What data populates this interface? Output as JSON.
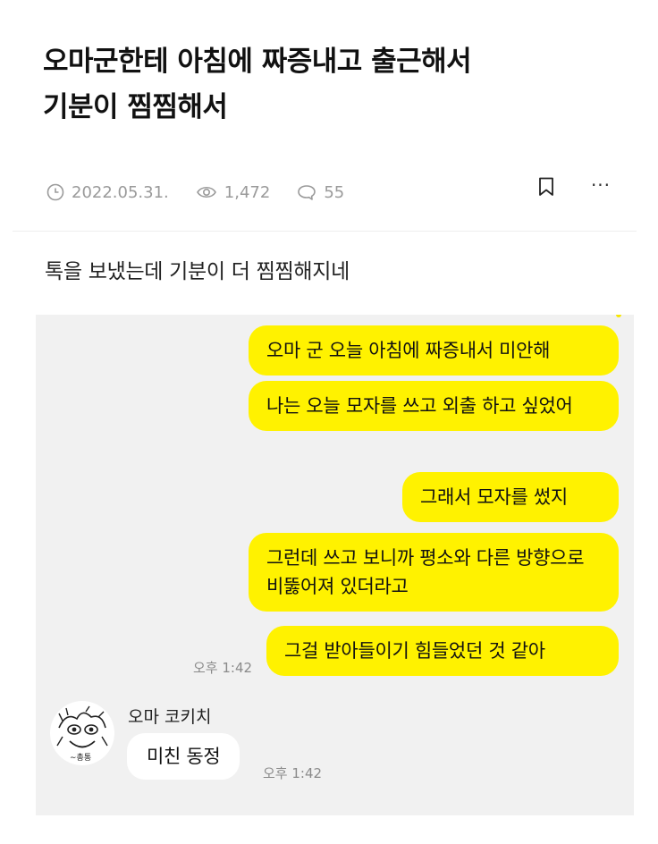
{
  "post": {
    "title_line1": "오마군한테 아침에 짜증내고 출근해서",
    "title_line2": "기분이 찜찜해서",
    "date": "2022.05.31.",
    "views": "1,472",
    "comments": "55",
    "more_label": "···",
    "body": "톡을 보냈는데 기분이 더 찜찜해지네"
  },
  "chat": {
    "sent": [
      {
        "text": "오마 군 오늘 아침에 짜증내서 미안해"
      },
      {
        "text": "나는 오늘 모자를 쓰고 외출 하고 싶었어"
      },
      {
        "text": "그래서 모자를 썼지"
      },
      {
        "text": "그런데 쓰고 보니까 평소와 다른 방향으로 비뚫어져 있더라고"
      },
      {
        "text": "그걸 받아들이기 힘들었던 것 같아"
      }
    ],
    "sent_time": "오후 1:42",
    "reply_sender": "오마 코키치",
    "reply_text": "미친 동정",
    "reply_time": "오후 1:42",
    "avatar_caption": "∼총통"
  },
  "colors": {
    "sent_bubble": "#fff200",
    "chat_background": "#f1f1f1",
    "meta_gray": "#9a9a9a"
  }
}
